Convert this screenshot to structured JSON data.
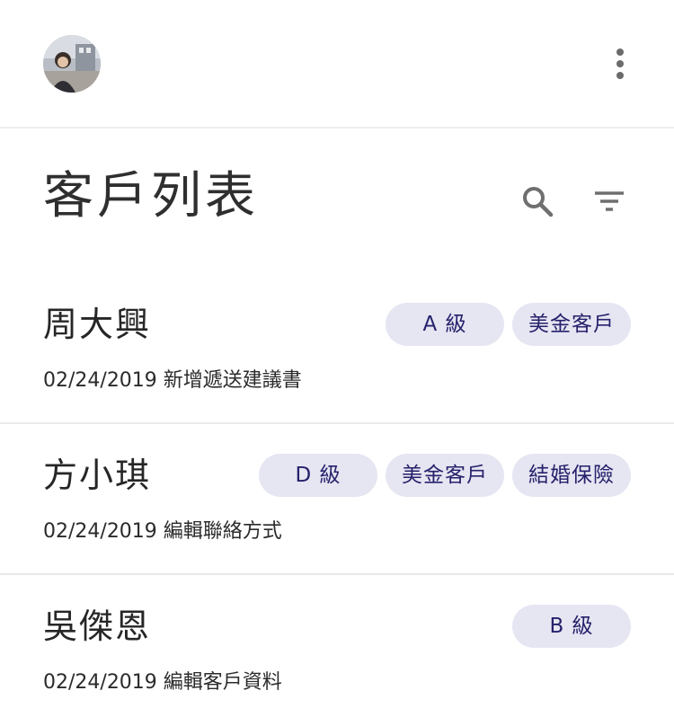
{
  "header": {
    "title": "客戶列表"
  },
  "icons": {
    "avatar": "user-avatar",
    "more": "more-vertical-icon",
    "search": "search-icon",
    "filter": "filter-icon"
  },
  "colors": {
    "tag_background": "#e6e5f2",
    "tag_text": "#25216b",
    "divider": "#e9e9e9"
  },
  "customers": [
    {
      "name": "周大興",
      "tags": [
        "A 級",
        "美金客戶"
      ],
      "activity": "02/24/2019 新增遞送建議書"
    },
    {
      "name": "方小琪",
      "tags": [
        "D 級",
        "美金客戶",
        "結婚保險"
      ],
      "activity": "02/24/2019 編輯聯絡方式"
    },
    {
      "name": "吳傑恩",
      "tags": [
        "B 級"
      ],
      "activity": "02/24/2019 編輯客戶資料"
    }
  ]
}
